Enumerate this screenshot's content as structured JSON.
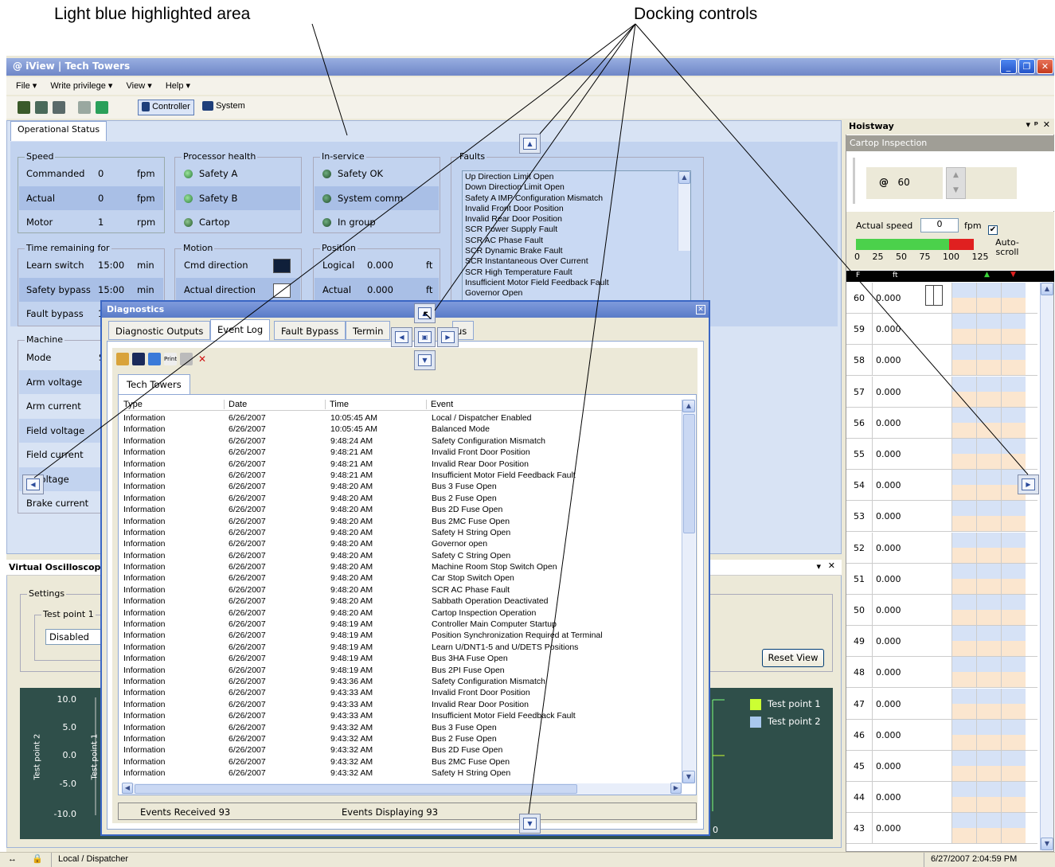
{
  "annotations": {
    "highlight_label": "Light blue highlighted area",
    "docking_label": "Docking controls"
  },
  "window": {
    "title": "iView | Tech Towers"
  },
  "menu": [
    "File ▾",
    "Write privilege ▾",
    "View ▾",
    "Help ▾"
  ],
  "toolbar": {
    "controller_label": "Controller",
    "system_label": "System"
  },
  "operational": {
    "tab": "Operational Status",
    "speed": {
      "title": "Speed",
      "rows": [
        {
          "label": "Commanded",
          "value": "0",
          "unit": "fpm"
        },
        {
          "label": "Actual",
          "value": "0",
          "unit": "fpm"
        },
        {
          "label": "Motor",
          "value": "1",
          "unit": "rpm"
        }
      ]
    },
    "processor": {
      "title": "Processor health",
      "items": [
        "Safety A",
        "Safety B",
        "Cartop"
      ]
    },
    "inservice": {
      "title": "In-service",
      "items": [
        "Safety OK",
        "System comm",
        "In group"
      ]
    },
    "faults": {
      "title": "Faults",
      "items": [
        "Up Direction Limit Open",
        "Down Direction Limit Open",
        "Safety A IMP Configuration Mismatch",
        "Invalid Front Door Position",
        "Invalid Rear Door Position",
        "SCR Power Supply Fault",
        "SCR AC Phase Fault",
        "SCR Dynamic Brake Fault",
        "SCR Instantaneous Over Current",
        "SCR High Temperature Fault",
        "Insufficient Motor Field Feedback Fault",
        "Governor Open"
      ]
    },
    "time": {
      "title": "Time remaining for",
      "rows": [
        {
          "label": "Learn switch",
          "value": "15:00",
          "unit": "min"
        },
        {
          "label": "Safety bypass",
          "value": "15:00",
          "unit": "min"
        },
        {
          "label": "Fault bypass",
          "value": "1",
          "unit": ""
        }
      ]
    },
    "motion": {
      "title": "Motion",
      "rows": [
        "Cmd direction",
        "Actual direction"
      ]
    },
    "position": {
      "title": "Position",
      "rows": [
        {
          "label": "Logical",
          "value": "0.000",
          "unit": "ft"
        },
        {
          "label": "Actual",
          "value": "0.000",
          "unit": "ft"
        }
      ]
    },
    "machine": {
      "title": "Machine",
      "rows": [
        "Mode",
        "Arm voltage",
        "Arm current",
        "Field voltage",
        "Field current",
        "e voltage",
        "Brake current"
      ],
      "mode_value": "S"
    }
  },
  "oscilloscope": {
    "title": "Virtual Oscilloscope",
    "settings_title": "Settings",
    "testpoint1_title": "Test point 1",
    "select_value": "Disabled",
    "reset_button": "Reset View",
    "y_ticks": [
      "10.0",
      "5.0",
      "0.0",
      "-5.0",
      "-10.0"
    ],
    "y_label_1": "Test point 1",
    "y_label_2": "Test point 2",
    "legend": [
      {
        "name": "Test point 1",
        "color": "#ccff33"
      },
      {
        "name": "Test point 2",
        "color": "#a9c8ee"
      }
    ],
    "x_tail": "0"
  },
  "diagnostics": {
    "title": "Diagnostics",
    "tabs": [
      "Diagnostic Outputs",
      "Event Log",
      "Fault Bypass",
      "Termin",
      "us"
    ],
    "sub_tab": "Tech Towers",
    "columns": [
      "Type",
      "Date",
      "Time",
      "Event"
    ],
    "rows": [
      [
        "Information",
        "6/26/2007",
        "10:05:45 AM",
        "Local / Dispatcher Enabled"
      ],
      [
        "Information",
        "6/26/2007",
        "10:05:45 AM",
        "Balanced Mode"
      ],
      [
        "Information",
        "6/26/2007",
        "9:48:24 AM",
        "Safety Configuration Mismatch"
      ],
      [
        "Information",
        "6/26/2007",
        "9:48:21 AM",
        "Invalid Front Door Position"
      ],
      [
        "Information",
        "6/26/2007",
        "9:48:21 AM",
        "Invalid Rear Door Position"
      ],
      [
        "Information",
        "6/26/2007",
        "9:48:21 AM",
        "Insufficient Motor Field Feedback Fault"
      ],
      [
        "Information",
        "6/26/2007",
        "9:48:20 AM",
        "Bus 3 Fuse Open"
      ],
      [
        "Information",
        "6/26/2007",
        "9:48:20 AM",
        "Bus 2 Fuse Open"
      ],
      [
        "Information",
        "6/26/2007",
        "9:48:20 AM",
        "Bus 2D Fuse Open"
      ],
      [
        "Information",
        "6/26/2007",
        "9:48:20 AM",
        "Bus 2MC Fuse Open"
      ],
      [
        "Information",
        "6/26/2007",
        "9:48:20 AM",
        "Safety H String Open"
      ],
      [
        "Information",
        "6/26/2007",
        "9:48:20 AM",
        "Governor open"
      ],
      [
        "Information",
        "6/26/2007",
        "9:48:20 AM",
        "Safety C String Open"
      ],
      [
        "Information",
        "6/26/2007",
        "9:48:20 AM",
        "Machine Room Stop Switch Open"
      ],
      [
        "Information",
        "6/26/2007",
        "9:48:20 AM",
        "Car Stop Switch Open"
      ],
      [
        "Information",
        "6/26/2007",
        "9:48:20 AM",
        "SCR AC Phase Fault"
      ],
      [
        "Information",
        "6/26/2007",
        "9:48:20 AM",
        "Sabbath Operation Deactivated"
      ],
      [
        "Information",
        "6/26/2007",
        "9:48:20 AM",
        "Cartop Inspection Operation"
      ],
      [
        "Information",
        "6/26/2007",
        "9:48:19 AM",
        "Controller Main Computer Startup"
      ],
      [
        "Information",
        "6/26/2007",
        "9:48:19 AM",
        "Position Synchronization Required at Terminal"
      ],
      [
        "Information",
        "6/26/2007",
        "9:48:19 AM",
        "Learn U/DNT1-5 and U/DETS Positions"
      ],
      [
        "Information",
        "6/26/2007",
        "9:48:19 AM",
        "Bus 3HA Fuse Open"
      ],
      [
        "Information",
        "6/26/2007",
        "9:48:19 AM",
        "Bus 2PI Fuse Open"
      ],
      [
        "Information",
        "6/26/2007",
        "9:43:36 AM",
        "Safety Configuration Mismatch"
      ],
      [
        "Information",
        "6/26/2007",
        "9:43:33 AM",
        "Invalid Front Door Position"
      ],
      [
        "Information",
        "6/26/2007",
        "9:43:33 AM",
        "Invalid Rear Door Position"
      ],
      [
        "Information",
        "6/26/2007",
        "9:43:33 AM",
        "Insufficient Motor Field Feedback Fault"
      ],
      [
        "Information",
        "6/26/2007",
        "9:43:32 AM",
        "Bus 3 Fuse Open"
      ],
      [
        "Information",
        "6/26/2007",
        "9:43:32 AM",
        "Bus 2 Fuse Open"
      ],
      [
        "Information",
        "6/26/2007",
        "9:43:32 AM",
        "Bus 2D Fuse Open"
      ],
      [
        "Information",
        "6/26/2007",
        "9:43:32 AM",
        "Bus 2MC Fuse Open"
      ],
      [
        "Information",
        "6/26/2007",
        "9:43:32 AM",
        "Safety H String Open"
      ]
    ],
    "events_received": "Events Received 93",
    "events_displaying": "Events Displaying 93"
  },
  "hoistway": {
    "title": "Hoistway",
    "mode": "Cartop Inspection",
    "at_label": "@",
    "floor_value": "60",
    "actual_speed_label": "Actual speed",
    "actual_speed_value": "0",
    "speed_unit": "fpm",
    "autoscroll": "Auto-scroll",
    "scale": [
      "0",
      "25",
      "50",
      "75",
      "100",
      "125"
    ],
    "col_f": "F",
    "col_ft": "ft",
    "floors": [
      {
        "f": "60",
        "ft": "0.000"
      },
      {
        "f": "59",
        "ft": "0.000"
      },
      {
        "f": "58",
        "ft": "0.000"
      },
      {
        "f": "57",
        "ft": "0.000"
      },
      {
        "f": "56",
        "ft": "0.000"
      },
      {
        "f": "55",
        "ft": "0.000"
      },
      {
        "f": "54",
        "ft": "0.000"
      },
      {
        "f": "53",
        "ft": "0.000"
      },
      {
        "f": "52",
        "ft": "0.000"
      },
      {
        "f": "51",
        "ft": "0.000"
      },
      {
        "f": "50",
        "ft": "0.000"
      },
      {
        "f": "49",
        "ft": "0.000"
      },
      {
        "f": "48",
        "ft": "0.000"
      },
      {
        "f": "47",
        "ft": "0.000"
      },
      {
        "f": "46",
        "ft": "0.000"
      },
      {
        "f": "45",
        "ft": "0.000"
      },
      {
        "f": "44",
        "ft": "0.000"
      },
      {
        "f": "43",
        "ft": "0.000"
      }
    ]
  },
  "statusbar": {
    "mode": "Local / Dispatcher",
    "datetime": "6/27/2007 2:04:59 PM"
  }
}
